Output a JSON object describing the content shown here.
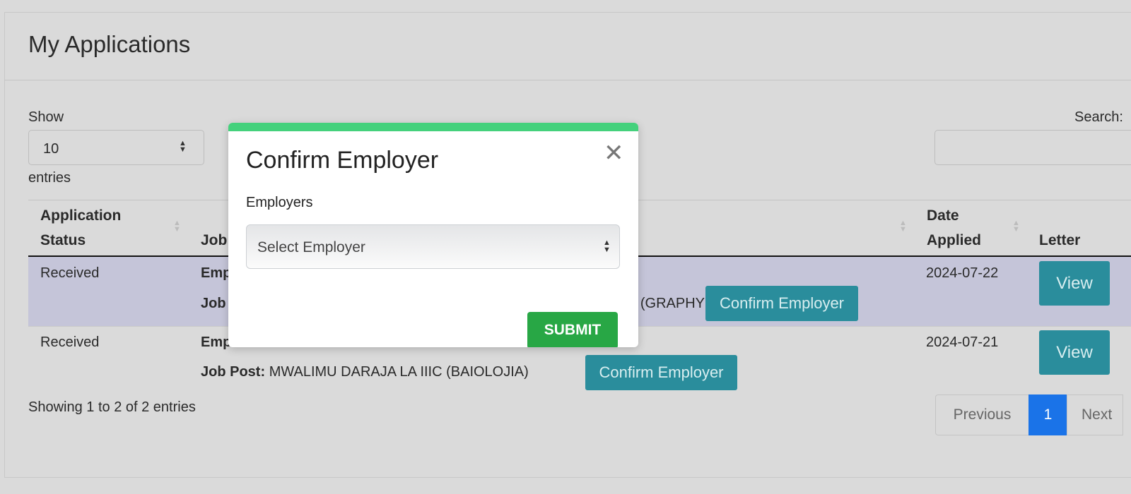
{
  "page": {
    "title": "My Applications"
  },
  "length": {
    "show_label": "Show",
    "value": "10",
    "entries_label": "entries"
  },
  "search": {
    "label": "Search:",
    "value": ""
  },
  "table": {
    "headers": {
      "status": [
        "Application",
        "Status"
      ],
      "job": "Job",
      "date": [
        "Date",
        "Applied"
      ],
      "letter": "Letter"
    },
    "rows": [
      {
        "status": "Received",
        "employer_label": "Emp",
        "job_label": "Job",
        "job_value_tail": "GRAPHY)",
        "confirm": "Confirm Employer",
        "date": "2024-07-22",
        "view": "View"
      },
      {
        "status": "Received",
        "employer_label": "Emp",
        "job_label": "Job Post:",
        "job_value": "MWALIMU DARAJA LA IIIC (BAIOLOJIA)",
        "confirm": "Confirm Employer",
        "date": "2024-07-21",
        "view": "View"
      }
    ]
  },
  "info": "Showing 1 to 2 of 2 entries",
  "pagination": {
    "previous": "Previous",
    "current": "1",
    "next": "Next"
  },
  "modal": {
    "title": "Confirm Employer",
    "label": "Employers",
    "select_value": "Select Employer",
    "submit": "SUBMIT",
    "accent": "#44d17c",
    "submit_color": "#28a745",
    "close_icon": "close-icon"
  },
  "colors": {
    "teal": "#2a8d9c",
    "active_page": "#1a73e8"
  }
}
